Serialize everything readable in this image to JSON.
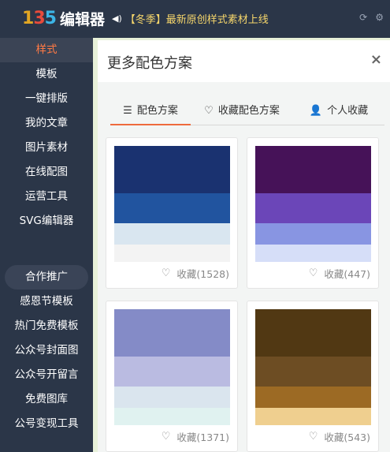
{
  "header": {
    "logo_mark": [
      "1",
      "3",
      "5"
    ],
    "logo_text": "编辑器",
    "notice_icon": "speaker-icon",
    "notice": "【冬季】最新原创样式素材上线",
    "icons": [
      "refresh-icon",
      "settings-icon"
    ]
  },
  "sidebar": {
    "items": [
      {
        "label": "样式",
        "active": true
      },
      {
        "label": "模板"
      },
      {
        "label": "一键排版"
      },
      {
        "label": "我的文章"
      },
      {
        "label": "图片素材"
      },
      {
        "label": "在线配图"
      },
      {
        "label": "运营工具"
      },
      {
        "label": "SVG编辑器"
      }
    ],
    "extra_items": [
      {
        "label": "合作推广"
      },
      {
        "label": "感恩节模板"
      },
      {
        "label": "热门免费模板"
      },
      {
        "label": "公众号封面图"
      },
      {
        "label": "公众号开留言"
      },
      {
        "label": "免费图库"
      },
      {
        "label": "公号变现工具"
      }
    ]
  },
  "panel": {
    "title": "更多配色方案",
    "close": "×",
    "tabs": [
      {
        "icon": "☰",
        "label": "配色方案",
        "active": true
      },
      {
        "icon": "♡",
        "label": "收藏配色方案"
      },
      {
        "icon": "👤",
        "label": "个人收藏"
      }
    ],
    "schemes": [
      {
        "colors": [
          "#1a3270",
          "#21549f",
          "#d9e6f0",
          "#f3f3f3"
        ],
        "fav_label": "收藏(1528)"
      },
      {
        "colors": [
          "#461258",
          "#6b46b8",
          "#8895e2",
          "#d6def8"
        ],
        "fav_label": "收藏(447)"
      },
      {
        "colors": [
          "#848bc7",
          "#babbe1",
          "#dae5ee",
          "#e0f2f0"
        ],
        "fav_label": "收藏(1371)"
      },
      {
        "colors": [
          "#513813",
          "#6d4d23",
          "#9c6a24",
          "#efcf8f"
        ],
        "fav_label": "收藏(543)"
      }
    ]
  }
}
